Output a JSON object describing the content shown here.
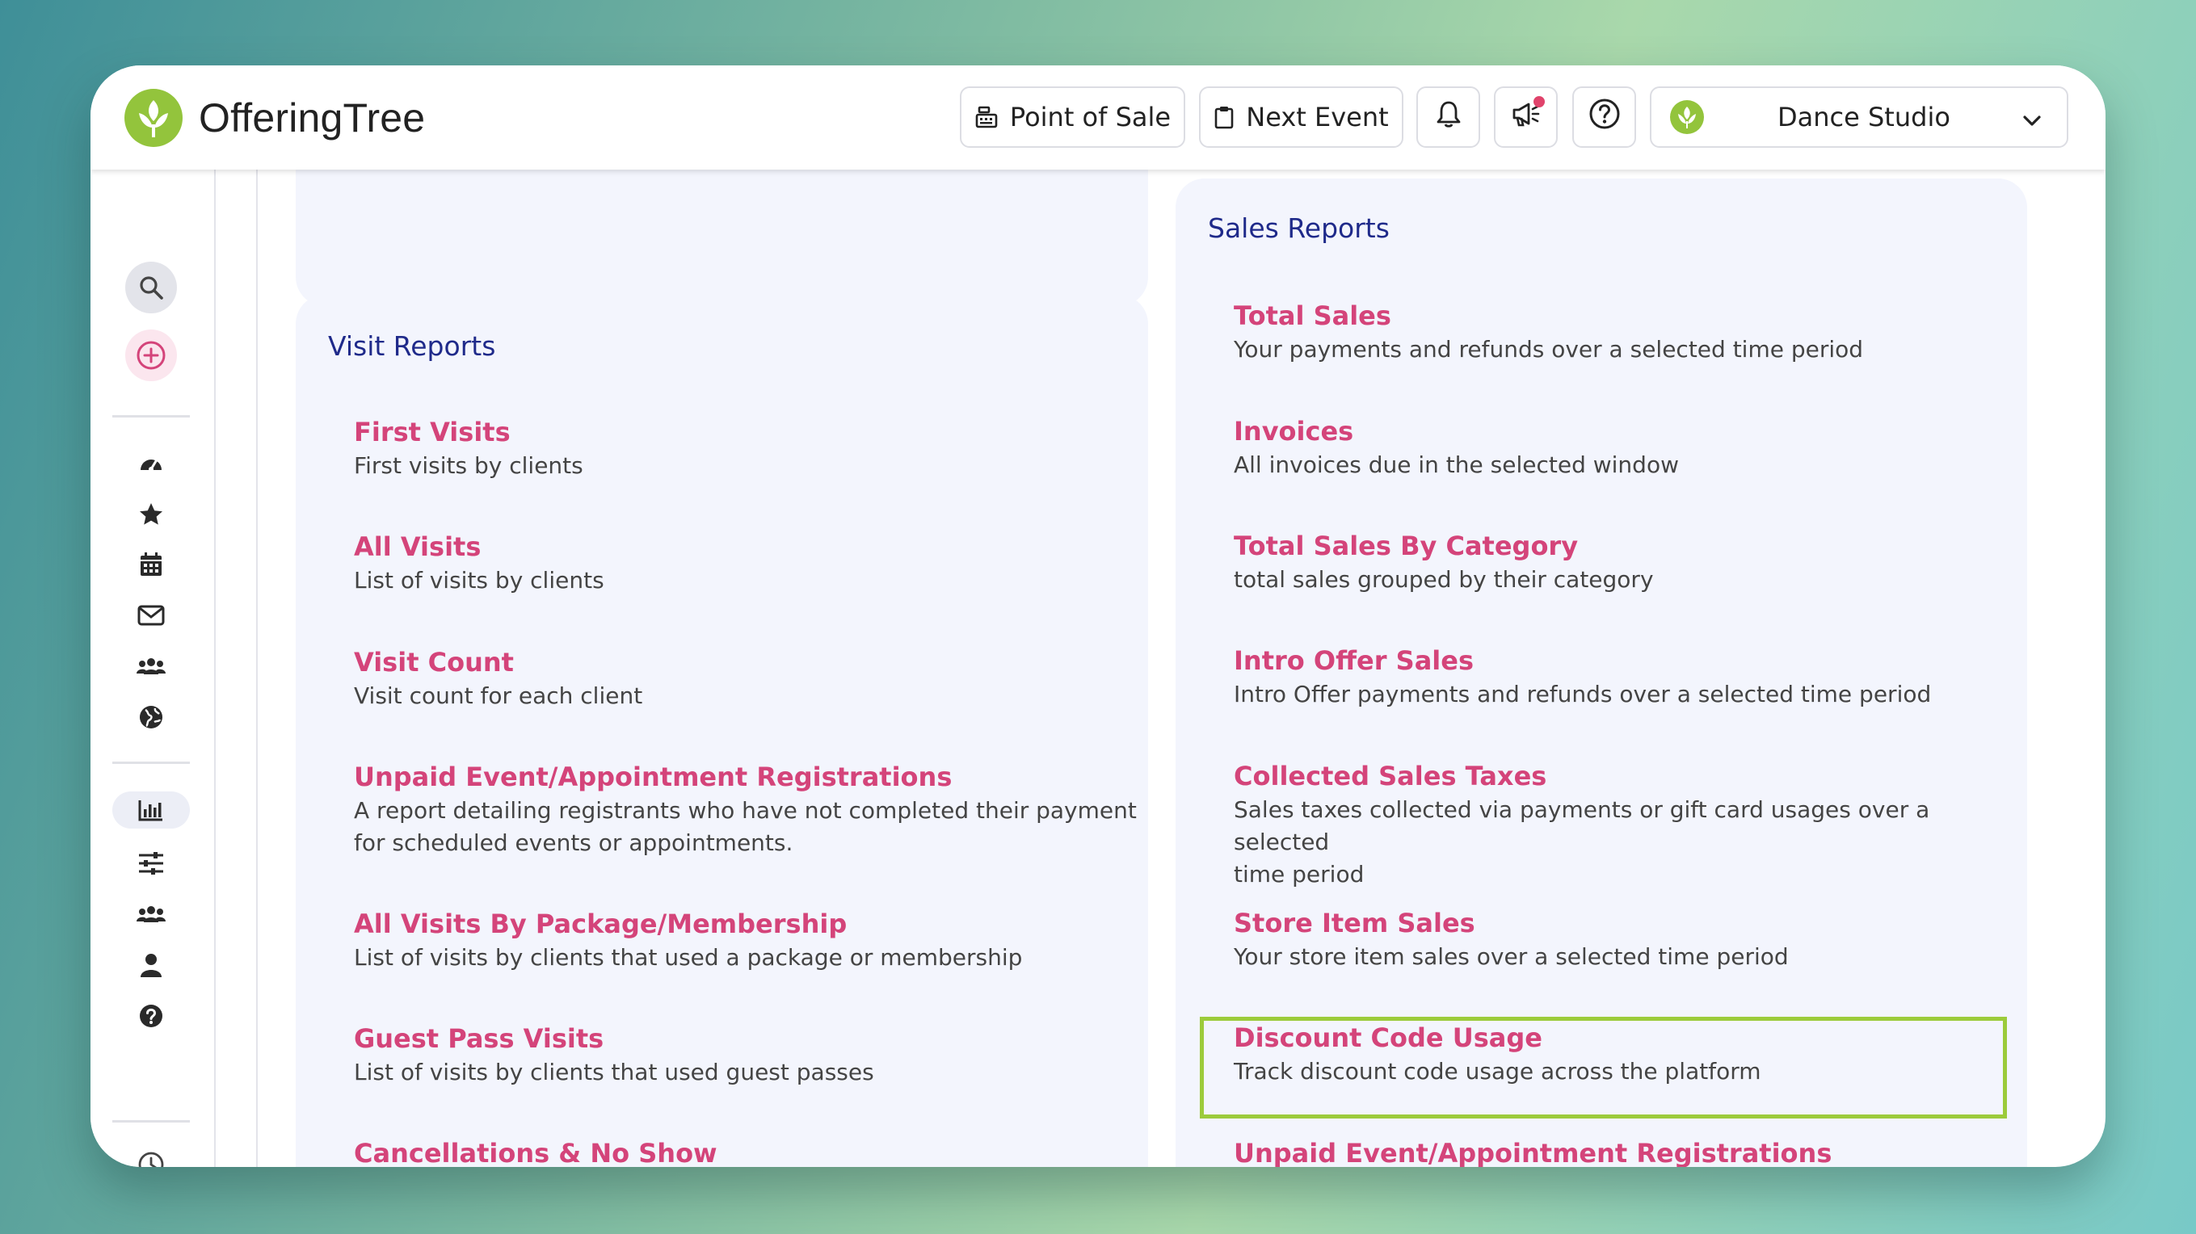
{
  "app": {
    "name": "OfferingTree"
  },
  "header": {
    "point_of_sale_label": "Point of Sale",
    "next_event_label": "Next Event",
    "studio_selector": {
      "selected": "Dance Studio"
    }
  },
  "colors": {
    "brand_green": "#93c43c",
    "report_title": "#d4447a",
    "section_title": "#1f2a8a",
    "highlight": "#9ccb3b",
    "panel_bg": "#f3f5fd"
  },
  "sidebar": {
    "top_icons": [
      "search-icon",
      "add-circle-icon"
    ],
    "nav_icons": [
      "dashboard-icon",
      "star-icon",
      "calendar-icon",
      "mail-icon",
      "users-icon",
      "globe-icon"
    ],
    "tool_icons": [
      "reports-chart-icon",
      "sliders-icon",
      "staff-icon",
      "person-icon",
      "help-icon"
    ],
    "bottom_icons": [
      "clock-icon",
      "chevron-right-icon"
    ]
  },
  "visit_reports": {
    "title": "Visit Reports",
    "items": [
      {
        "title": "First Visits",
        "desc": "First visits by clients"
      },
      {
        "title": "All Visits",
        "desc": "List of visits by clients"
      },
      {
        "title": "Visit Count",
        "desc": "Visit count for each client"
      },
      {
        "title": "Unpaid Event/Appointment Registrations",
        "desc": "A report detailing registrants who have not completed their payment",
        "desc2": "for scheduled events or appointments."
      },
      {
        "title": "All Visits By Package/Membership",
        "desc": "List of visits by clients that used a package or membership"
      },
      {
        "title": "Guest Pass Visits",
        "desc": "List of visits by clients that used guest passes"
      },
      {
        "title": "Cancellations & No Show"
      }
    ]
  },
  "sales_reports": {
    "title": "Sales Reports",
    "items": [
      {
        "title": "Total Sales",
        "desc": "Your payments and refunds over a selected time period"
      },
      {
        "title": "Invoices",
        "desc": "All invoices due in the selected window"
      },
      {
        "title": "Total Sales By Category",
        "desc": "total sales grouped by their category"
      },
      {
        "title": "Intro Offer Sales",
        "desc": "Intro Offer payments and refunds over a selected time period"
      },
      {
        "title": "Collected Sales Taxes",
        "desc": "Sales taxes collected via payments or gift card usages over a selected",
        "desc2": "time period"
      },
      {
        "title": "Store Item Sales",
        "desc": "Your store item sales over a selected time period"
      },
      {
        "title": "Discount Code Usage",
        "desc": "Track discount code usage across the platform"
      },
      {
        "title": "Unpaid Event/Appointment Registrations"
      }
    ]
  }
}
